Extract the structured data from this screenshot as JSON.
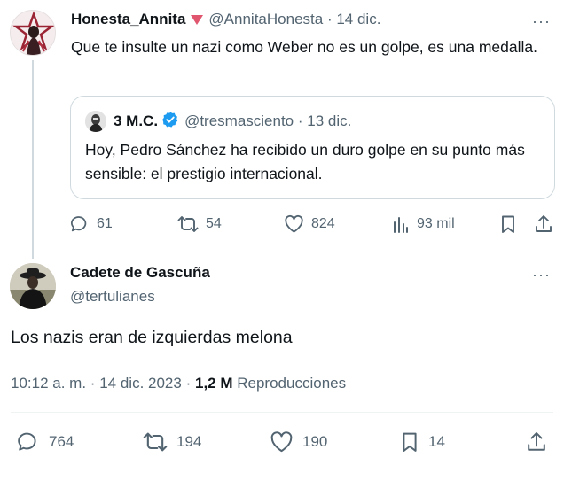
{
  "parent_tweet": {
    "display_name": "Honesta_Annita",
    "handle": "@AnnitaHonesta",
    "separator": "·",
    "date": "14 dic.",
    "text": "Que te insulte un nazi como Weber no es un golpe, es una medalla.",
    "quoted": {
      "display_name": "3 M.C.",
      "handle": "@tresmasciento",
      "separator": "·",
      "date": "13 dic.",
      "text": "Hoy, Pedro Sánchez ha recibido un duro golpe en su punto más sensible: el prestigio internacional."
    },
    "actions": {
      "replies": "61",
      "reposts": "54",
      "likes": "824",
      "views": "93 mil"
    }
  },
  "main_tweet": {
    "display_name": "Cadete de Gascuña",
    "handle": "@tertulianes",
    "text": "Los nazis eran de izquierdas melona",
    "time": "10:12 a. m.",
    "separator": "·",
    "date": "14 dic. 2023",
    "separator2": "·",
    "views_count": "1,2 M",
    "views_label": "Reproducciones",
    "actions": {
      "replies": "764",
      "reposts": "194",
      "likes": "190",
      "bookmarks": "14"
    }
  },
  "more_label": "···",
  "colors": {
    "text": "#0f1419",
    "secondary": "#536471",
    "verified": "#1d9bf0",
    "triangle": "#e0566f",
    "border": "#cfd9de"
  }
}
